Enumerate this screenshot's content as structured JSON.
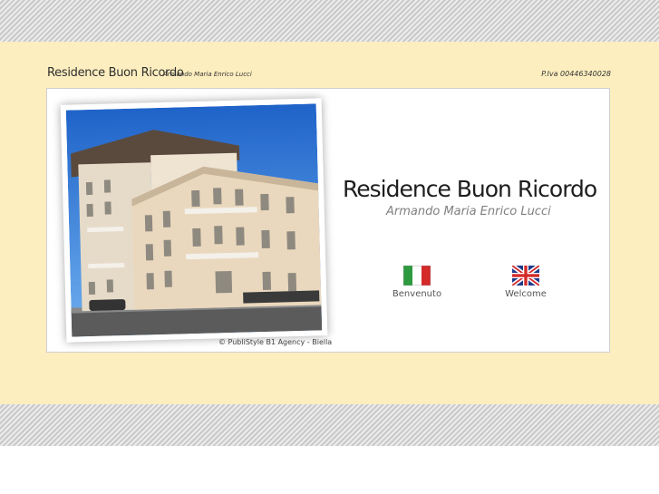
{
  "header": {
    "title": "Residence Buon Ricordo",
    "owner": "Armando Maria Enrico Lucci",
    "vat": "P.Iva 00446340028"
  },
  "main": {
    "title": "Residence Buon Ricordo",
    "subtitle": "Armando Maria Enrico Lucci",
    "photo_credit": "© PubliStyle B1 Agency - Biella"
  },
  "languages": [
    {
      "label": "Benvenuto",
      "flag_icon": "italy-flag-icon"
    },
    {
      "label": "Welcome",
      "flag_icon": "uk-flag-icon"
    }
  ],
  "colors": {
    "band": "#fdeebf",
    "stripes": "#d9d9d9",
    "sky": "#2f79d6",
    "building": "#e8d6bc"
  }
}
